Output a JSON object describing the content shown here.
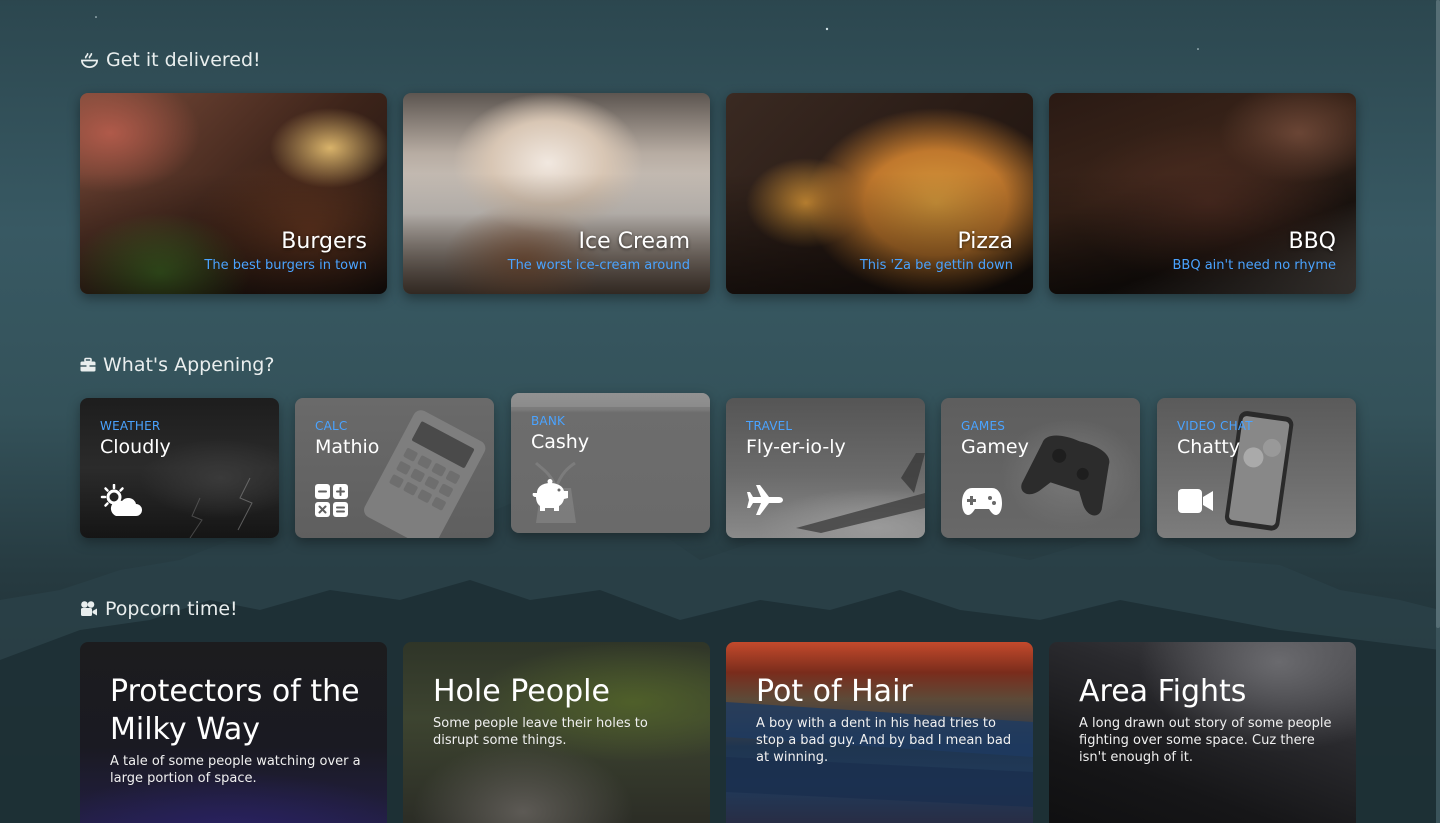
{
  "sections": {
    "delivery": {
      "title": "Get it delivered!",
      "icon": "food-bowl-icon"
    },
    "apps": {
      "title": "What's Appening?",
      "icon": "toolbox-icon"
    },
    "movies": {
      "title": "Popcorn time!",
      "icon": "video-camera-icon"
    }
  },
  "food": [
    {
      "title": "Burgers",
      "subtitle": "The best burgers in town"
    },
    {
      "title": "Ice Cream",
      "subtitle": "The worst ice-cream around"
    },
    {
      "title": "Pizza",
      "subtitle": "This 'Za be gettin down"
    },
    {
      "title": "BBQ",
      "subtitle": "BBQ ain't need no rhyme"
    }
  ],
  "apps": [
    {
      "category": "WEATHER",
      "name": "Cloudly",
      "icon": "sun-cloud-icon"
    },
    {
      "category": "CALC",
      "name": "Mathio",
      "icon": "calculator-icon"
    },
    {
      "category": "BANK",
      "name": "Cashy",
      "icon": "piggy-bank-icon"
    },
    {
      "category": "TRAVEL",
      "name": "Fly-er-io-ly",
      "icon": "plane-icon"
    },
    {
      "category": "GAMES",
      "name": "Gamey",
      "icon": "gamepad-icon"
    },
    {
      "category": "VIDEO CHAT",
      "name": "Chatty",
      "icon": "video-icon"
    }
  ],
  "movies": [
    {
      "title": "Protectors of the Milky Way",
      "description": "A tale of some people watching over a large portion of space."
    },
    {
      "title": "Hole People",
      "description": "Some people leave their holes to disrupt some things."
    },
    {
      "title": "Pot of Hair",
      "description": "A boy with a dent in his head tries to stop a bad guy. And by bad I mean bad at winning."
    },
    {
      "title": "Area Fights",
      "description": "A long drawn out story of some people fighting over some space. Cuz there isn't enough of it."
    }
  ],
  "colors": {
    "accent": "#4aa3ff",
    "background": "#34525a"
  }
}
